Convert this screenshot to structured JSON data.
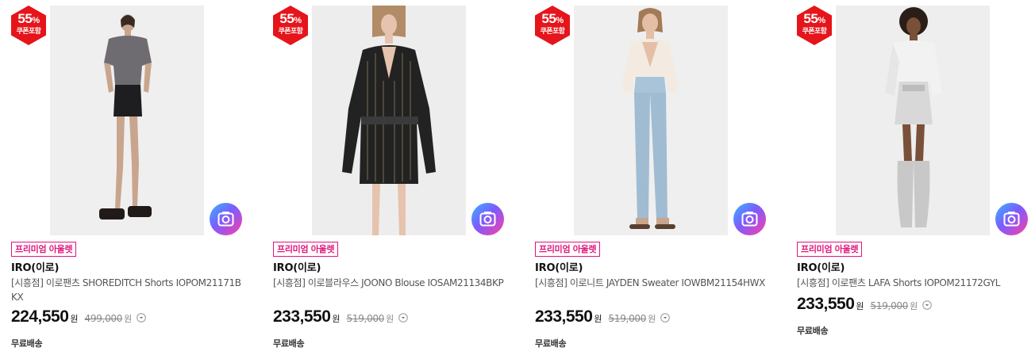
{
  "colors": {
    "badge_red": "#e5151b",
    "tag_pink": "#e0157b",
    "lens_gradient": [
      "#36b6ff",
      "#7b5cff",
      "#ff3ea5"
    ]
  },
  "products": [
    {
      "badge_pct": "55",
      "badge_pct_sign": "%",
      "badge_note": "쿠폰포함",
      "tag": "프리미엄 아울렛",
      "brand": "IRO(이로)",
      "title": "[시흥점] 이로팬츠 SHOREDITCH Shorts IOPOM21171BKX",
      "price": "224,550",
      "price_unit": "원",
      "orig_price": "499,000",
      "orig_unit": "원",
      "shipping": "무료배송",
      "lens_icon": "camera-lens-icon",
      "info_icon": "chevron-down-circle-icon"
    },
    {
      "badge_pct": "55",
      "badge_pct_sign": "%",
      "badge_note": "쿠폰포함",
      "tag": "프리미엄 아울렛",
      "brand": "IRO(이로)",
      "title": "[시흥점] 이로블라우스 JOONO Blouse IOSAM21134BKP",
      "price": "233,550",
      "price_unit": "원",
      "orig_price": "519,000",
      "orig_unit": "원",
      "shipping": "무료배송",
      "lens_icon": "camera-lens-icon",
      "info_icon": "chevron-down-circle-icon"
    },
    {
      "badge_pct": "55",
      "badge_pct_sign": "%",
      "badge_note": "쿠폰포함",
      "tag": "프리미엄 아울렛",
      "brand": "IRO(이로)",
      "title": "[시흥점] 이로니트 JAYDEN Sweater IOWBM21154HWX",
      "price": "233,550",
      "price_unit": "원",
      "orig_price": "519,000",
      "orig_unit": "원",
      "shipping": "무료배송",
      "lens_icon": "camera-lens-icon",
      "info_icon": "chevron-down-circle-icon"
    },
    {
      "badge_pct": "55",
      "badge_pct_sign": "%",
      "badge_note": "쿠폰포함",
      "tag": "프리미엄 아울렛",
      "brand": "IRO(이로)",
      "title": "[시흥점] 이로팬츠 LAFA Shorts IOPOM21172GYL",
      "price": "233,550",
      "price_unit": "원",
      "orig_price": "519,000",
      "orig_unit": "원",
      "shipping": "무료배송",
      "lens_icon": "camera-lens-icon",
      "info_icon": "chevron-down-circle-icon"
    }
  ]
}
